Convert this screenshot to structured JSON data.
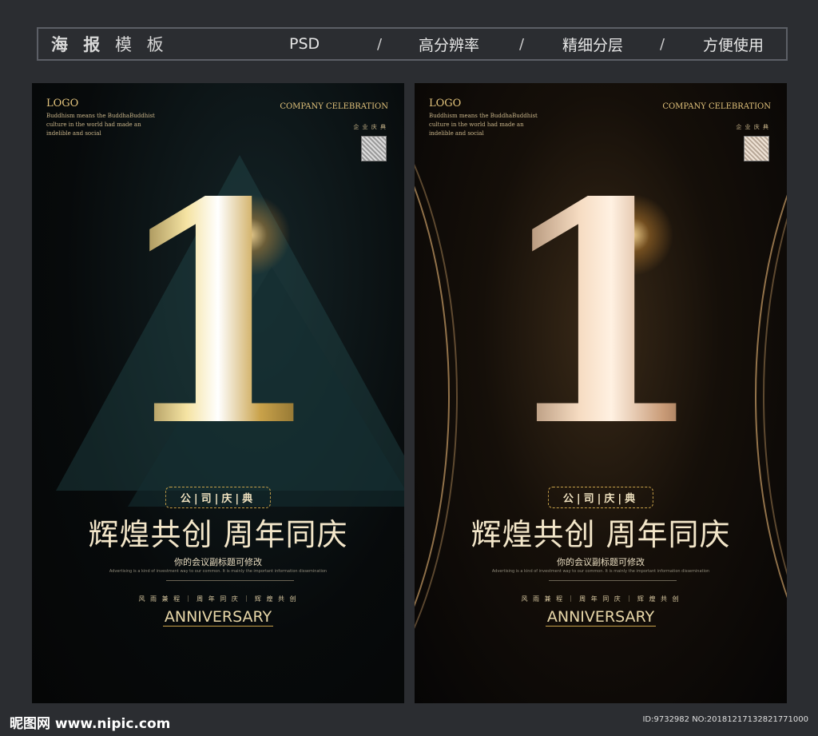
{
  "header": {
    "title_bold": "海 报",
    "title_rest": " 模 板",
    "features": [
      "PSD",
      "高分辨率",
      "精细分层",
      "方便使用"
    ],
    "separator": "/"
  },
  "poster": {
    "logo": "LOGO",
    "desc": "Buddhism means the BuddhaBuddhist culture in the world had made an indelible and social",
    "company": "COMPANY CELEBRATION",
    "company_cn": "企 业 庆 典",
    "big_number": "1",
    "badge": "公|司|庆|典",
    "headline": "辉煌共创 周年同庆",
    "subtitle": "你的会议副标题可修改",
    "small_text": "Advertising is a kind of investment way to our common. It is mainly the important information dissemination",
    "motto": "风 雨 兼 程 ｜ 周 年 同 庆 ｜ 辉 煌 共 创",
    "anniversary": "ANNIVERSARY"
  },
  "footer": {
    "site": "昵图网 www.nipic.com",
    "id": "ID:9732982 NO:20181217132821771000"
  },
  "colors": {
    "background": "#2b2d31",
    "gold": "#e1c27b",
    "rose_gold": "#f6dcc2"
  }
}
